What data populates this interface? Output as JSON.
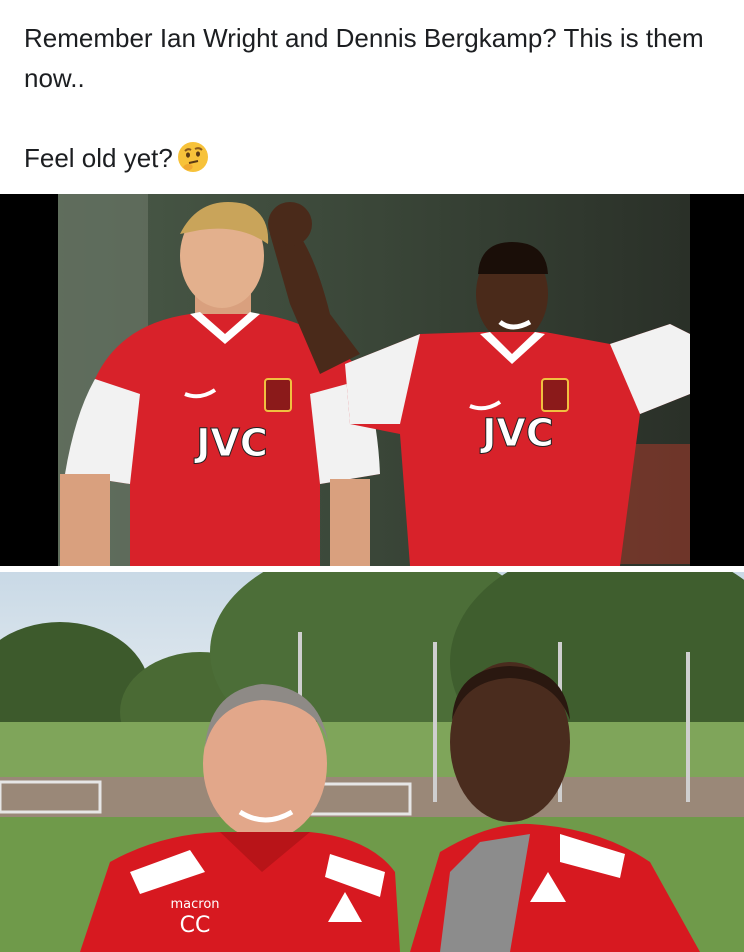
{
  "post": {
    "line1": "Remember Ian Wright and Dennis Bergkamp? This is them now..",
    "line2": "Feel old yet?",
    "emoji": "thinking-face-emoji"
  },
  "photo_top": {
    "left_shirt_sponsor": "JVC",
    "right_shirt_sponsor": "JVC",
    "shirt_color": "#d8222a",
    "sleeve_color": "#f2f2f2"
  },
  "photo_bottom": {
    "jacket_text": "macron",
    "jacket_initials": "CC",
    "jacket_color": "#d71920",
    "grass_color": "#6f9a4a"
  }
}
